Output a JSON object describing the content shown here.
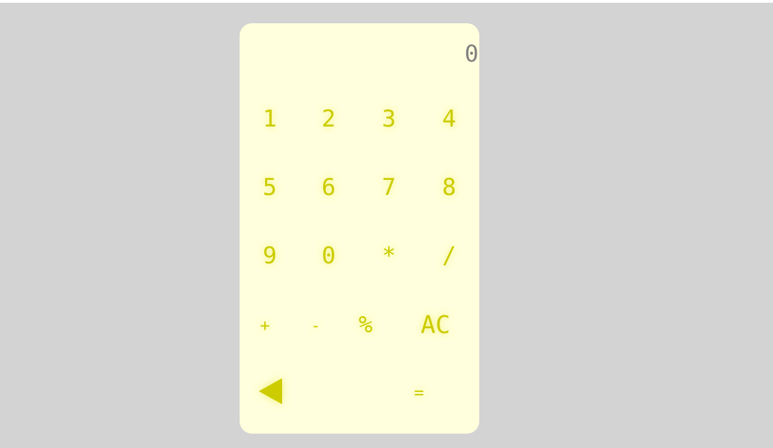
{
  "display": {
    "value": "0"
  },
  "keys": {
    "k1": "1",
    "k2": "2",
    "k3": "3",
    "k4": "4",
    "k5": "5",
    "k6": "6",
    "k7": "7",
    "k8": "8",
    "k9": "9",
    "k0": "0",
    "multiply": "*",
    "divide": "/",
    "plus": "+",
    "minus": "-",
    "percent": "%",
    "clear": "AC",
    "equals": "=",
    "backspace_icon": "backspace-triangle-icon"
  },
  "colors": {
    "page_background": "#d3d3d3",
    "calculator_background": "#ffffdd",
    "key_color": "#cccc00",
    "display_color": "#808080"
  }
}
